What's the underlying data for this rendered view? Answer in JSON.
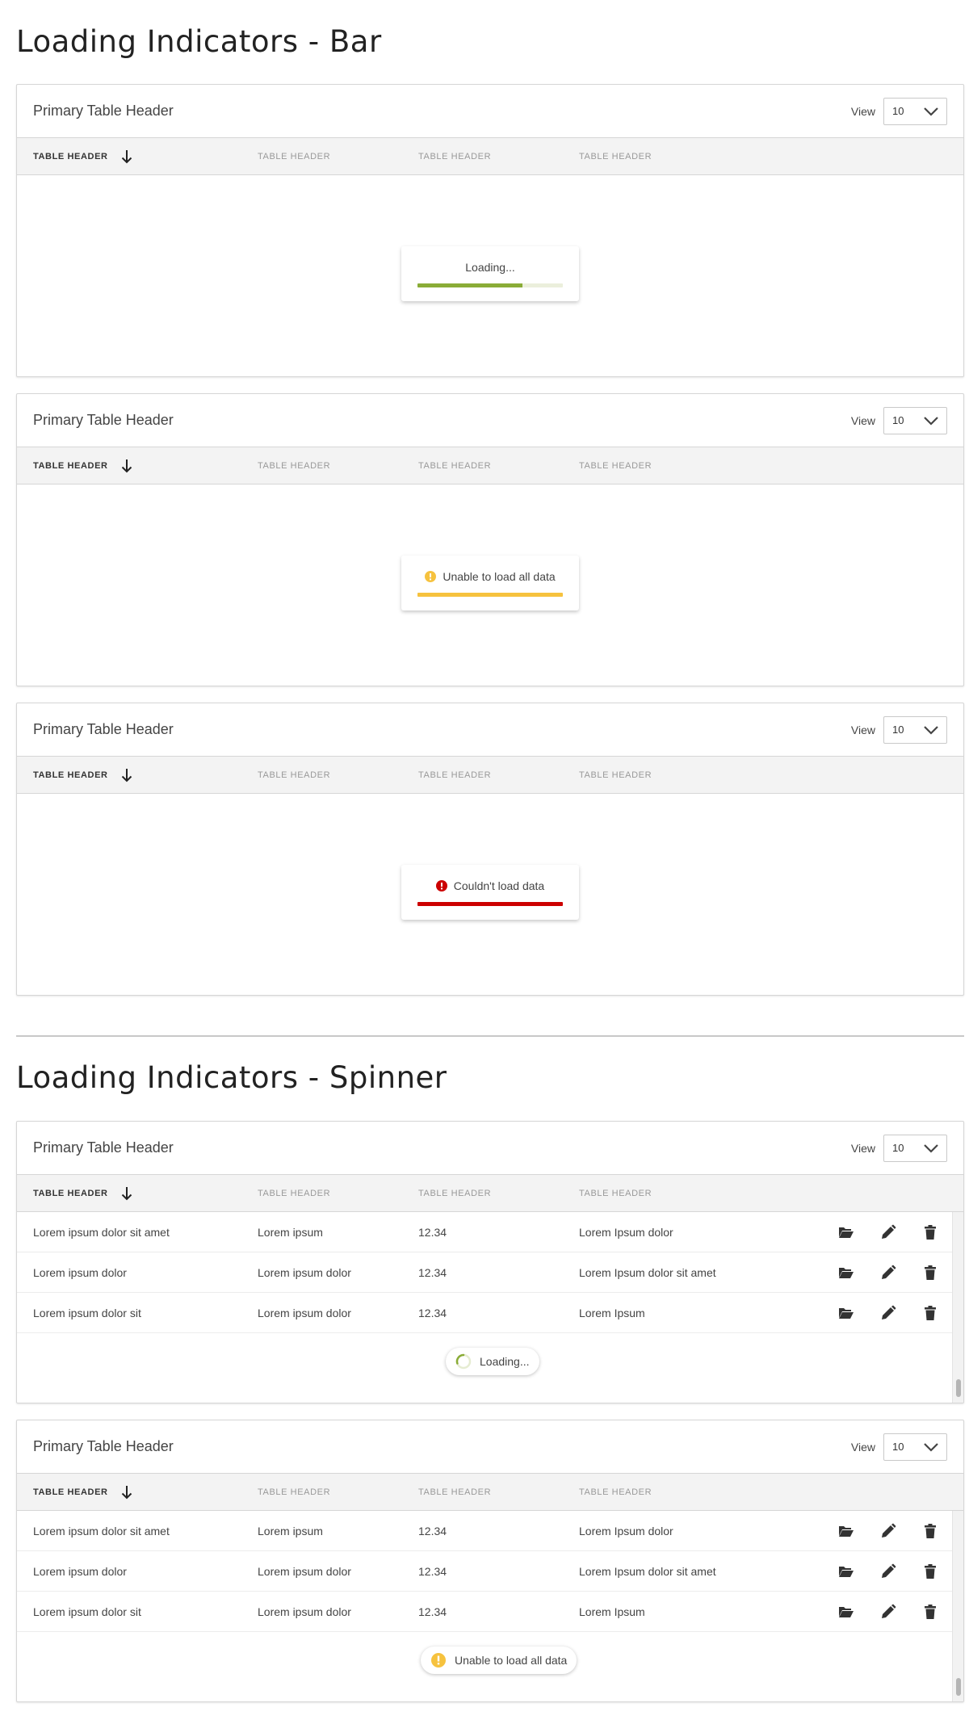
{
  "sections": {
    "bar_title": "Loading Indicators - Bar",
    "spinner_title": "Loading Indicators - Spinner"
  },
  "table_header": {
    "title": "Primary Table Header",
    "view_label": "View",
    "view_value": "10",
    "columns": [
      "TABLE HEADER",
      "TABLE HEADER",
      "TABLE HEADER",
      "TABLE HEADER"
    ]
  },
  "bar_states": {
    "loading": {
      "text": "Loading...",
      "progress": 0.72,
      "color": "#8aac37"
    },
    "partial": {
      "text": "Unable to load all data",
      "progress": 1.0,
      "color": "#f6c23e"
    },
    "error": {
      "text": "Couldn't load data",
      "progress": 1.0,
      "color": "#cc0000"
    }
  },
  "rows": [
    {
      "c1": "Lorem ipsum dolor sit amet",
      "c2": "Lorem ipsum",
      "c3": "12.34",
      "c4": "Lorem Ipsum dolor"
    },
    {
      "c1": "Lorem ipsum dolor",
      "c2": "Lorem ipsum dolor",
      "c3": "12.34",
      "c4": "Lorem Ipsum dolor sit amet"
    },
    {
      "c1": "Lorem ipsum dolor sit",
      "c2": "Lorem ipsum dolor",
      "c3": "12.34",
      "c4": "Lorem Ipsum"
    }
  ],
  "row_icons": [
    "folder-open-icon",
    "pencil-icon",
    "trash-icon"
  ],
  "spinner_states": {
    "loading": {
      "text": "Loading..."
    },
    "partial": {
      "text": "Unable to load all data"
    }
  },
  "colors": {
    "accent_green": "#8aac37",
    "warning_yellow": "#f6c23e",
    "error_red": "#cc0000"
  }
}
